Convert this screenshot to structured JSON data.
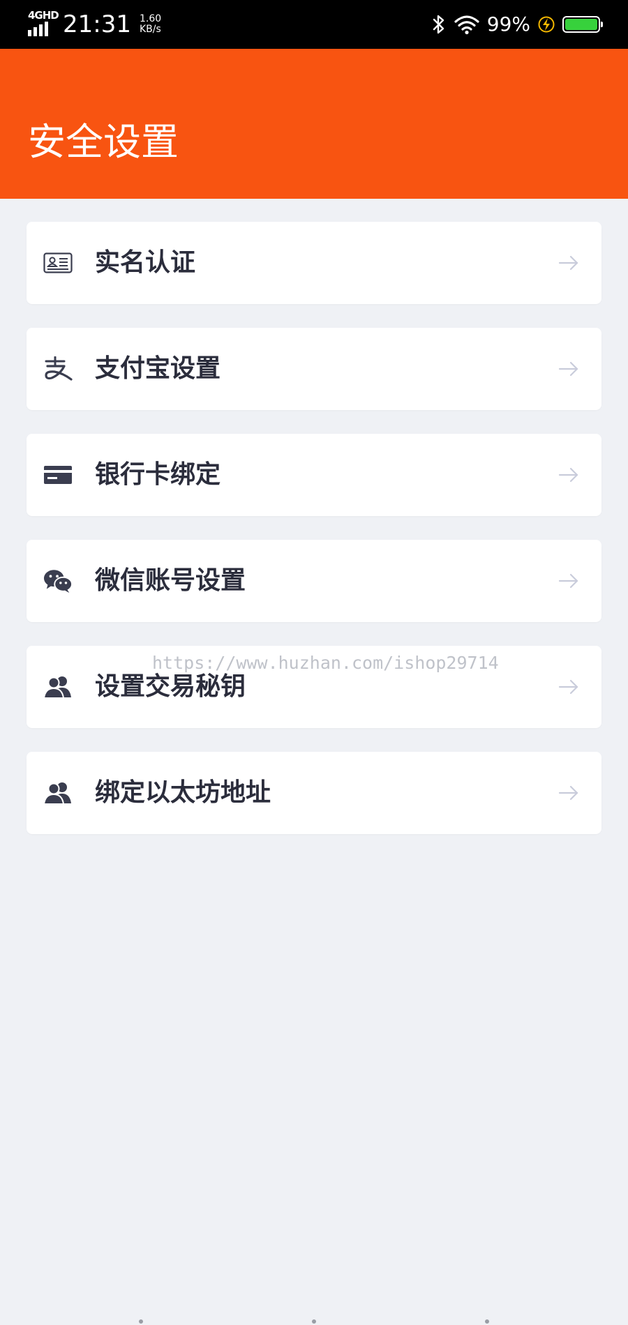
{
  "status_bar": {
    "network": "4GHD",
    "time": "21:31",
    "speed_value": "1.60",
    "speed_unit": "KB/s",
    "battery_percent": "99%",
    "battery_level": 0.99,
    "battery_color": "#37d13c",
    "icons": [
      "signal-icon",
      "bluetooth-icon",
      "wifi-icon",
      "charging-icon",
      "battery-icon"
    ]
  },
  "header": {
    "title": "安全设置",
    "background": "#f85411"
  },
  "menu": {
    "items": [
      {
        "label": "实名认证",
        "icon": "id-card-icon"
      },
      {
        "label": "支付宝设置",
        "icon": "alipay-icon"
      },
      {
        "label": "银行卡绑定",
        "icon": "bank-card-icon"
      },
      {
        "label": "微信账号设置",
        "icon": "wechat-icon"
      },
      {
        "label": "设置交易秘钥",
        "icon": "users-icon"
      },
      {
        "label": "绑定以太坊地址",
        "icon": "users-icon"
      }
    ]
  },
  "watermark": "https://www.huzhan.com/ishop29714"
}
